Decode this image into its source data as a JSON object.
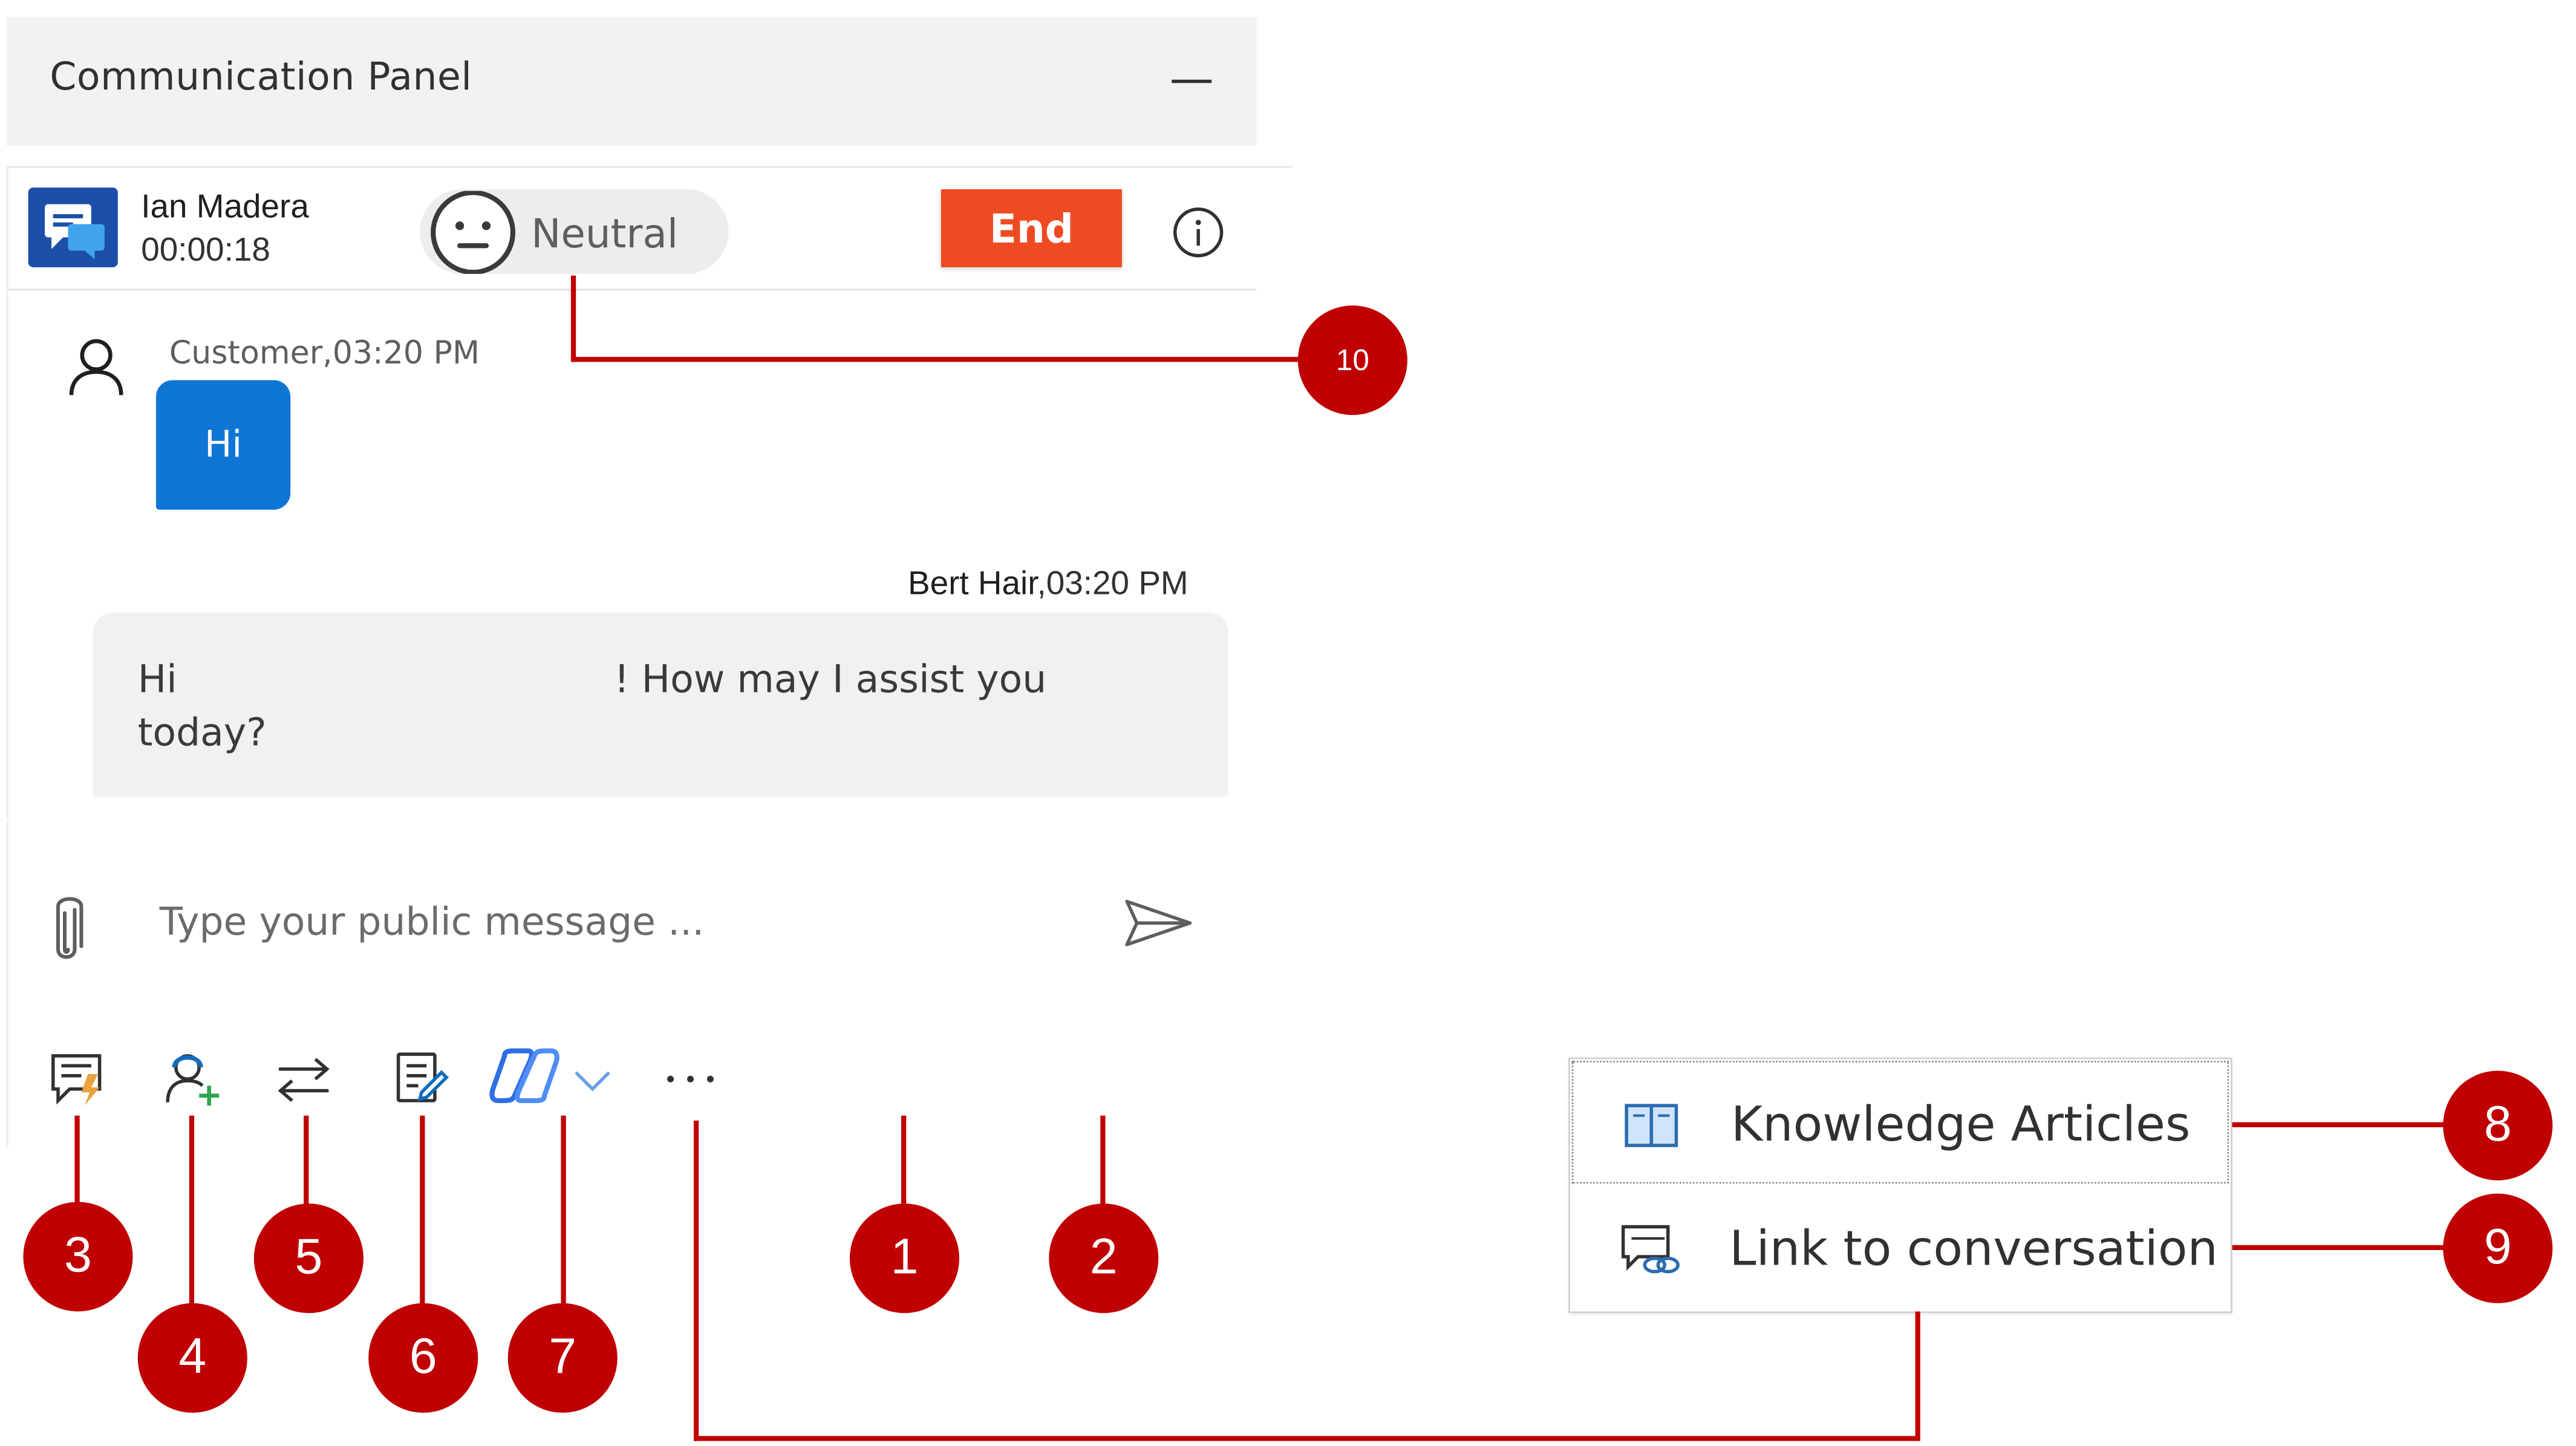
{
  "panel": {
    "title": "Communication Panel"
  },
  "session": {
    "contact_name": "Ian Madera",
    "timer": "00:00:18",
    "sentiment": "Neutral",
    "end_label": "End"
  },
  "messages": {
    "customer_meta": "Customer,03:20 PM",
    "customer_text": "Hi",
    "agent_name": "Bert Hair",
    "agent_time": ",03:20 PM",
    "agent_text_start": "Hi",
    "agent_text_mid": "! How may I assist you",
    "agent_text_end": "today?"
  },
  "composer": {
    "placeholder": "Type your public message ..."
  },
  "more_menu": {
    "items": [
      {
        "label": "Knowledge Articles",
        "icon": "book-icon"
      },
      {
        "label": "Link to conversation",
        "icon": "chat-link-icon"
      }
    ]
  },
  "callouts": [
    "1",
    "2",
    "3",
    "4",
    "5",
    "6",
    "7",
    "8",
    "9",
    "10"
  ],
  "colors": {
    "callout": "#c00000",
    "end_button": "#ef4b23",
    "customer_bubble": "#0f76d6",
    "channel_icon": "#1b4fa8"
  },
  "icons": {
    "toolbar": [
      "quick-replies-icon",
      "consult-icon",
      "transfer-icon",
      "notes-icon",
      "copilot-icon",
      "chevron-down-icon",
      "more-icon"
    ]
  }
}
